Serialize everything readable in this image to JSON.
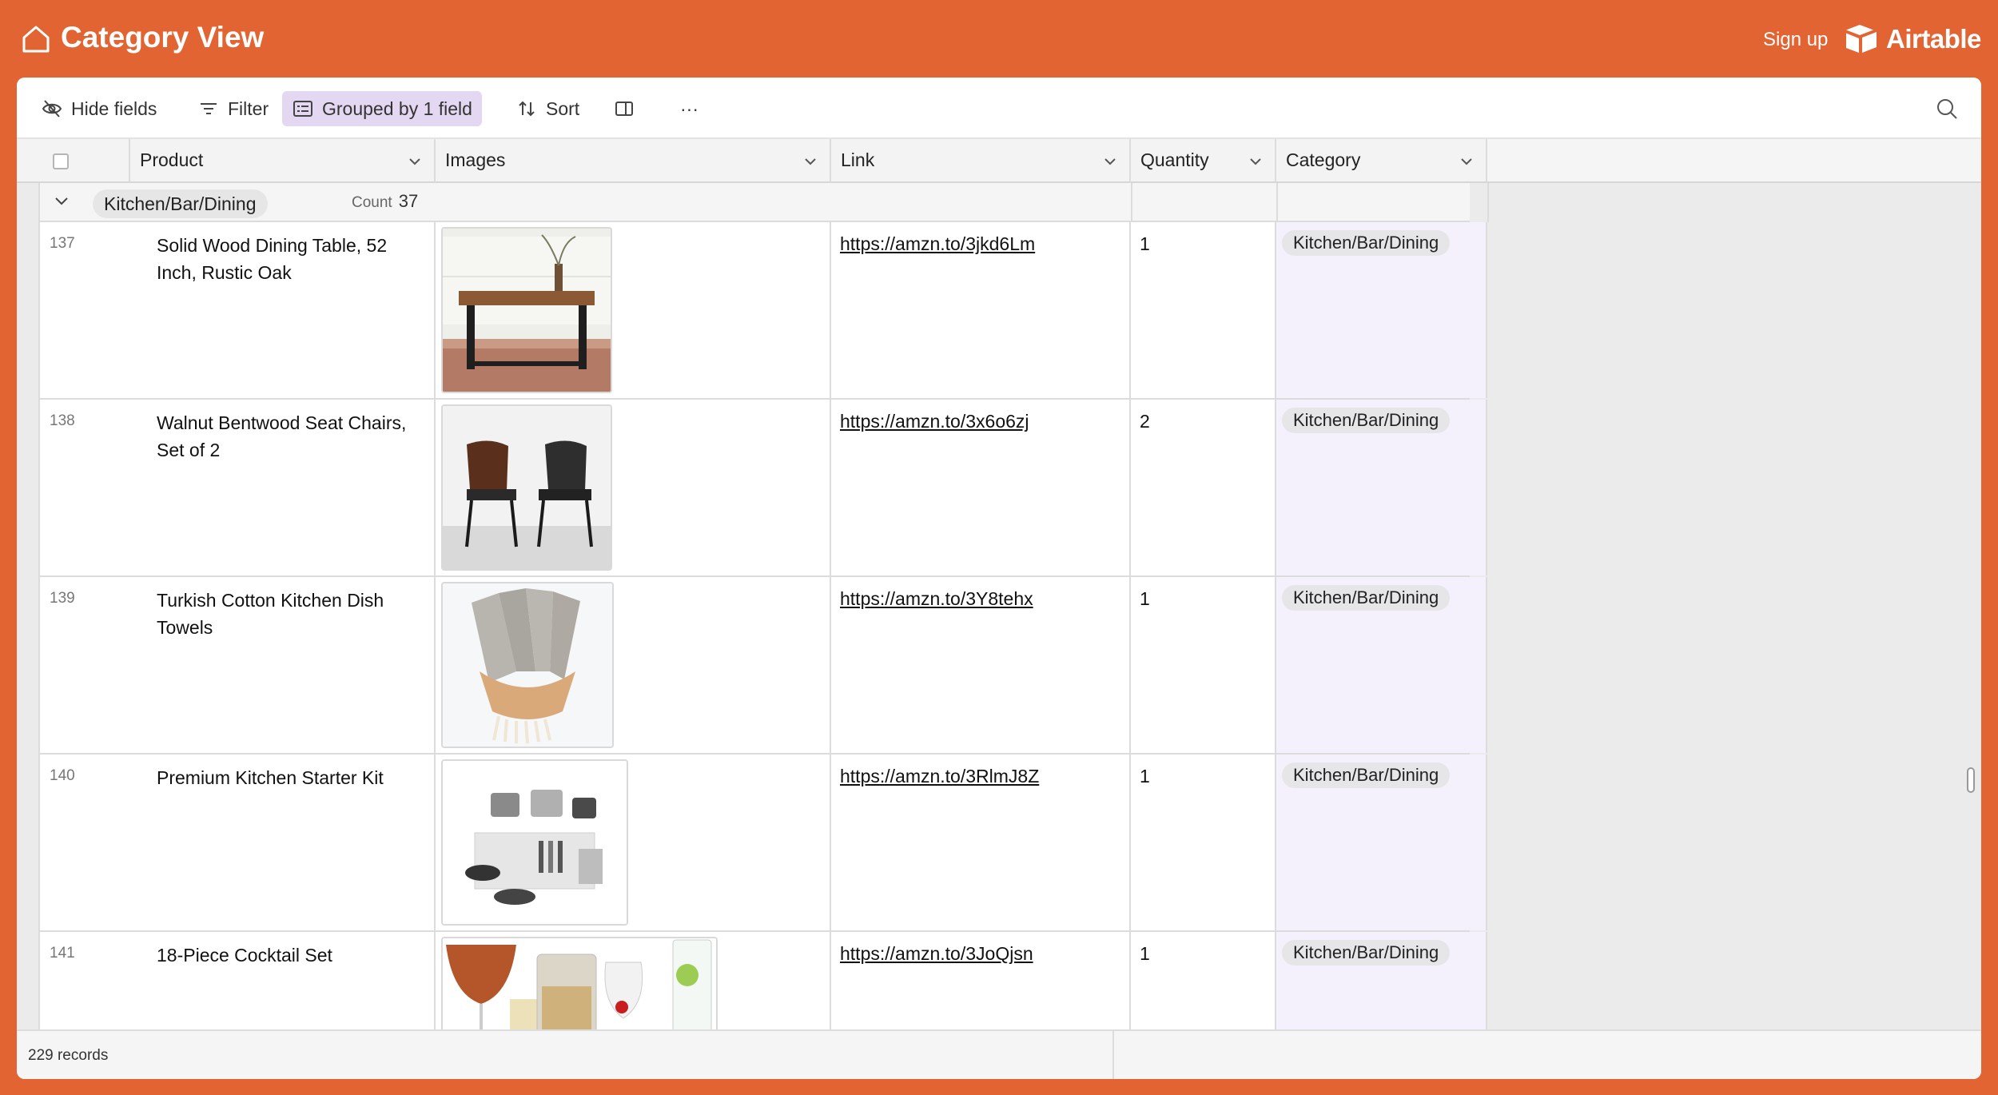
{
  "app": {
    "view_title": "Category View",
    "signup_label": "Sign up",
    "brand_name": "Airtable",
    "accent_color": "#e16432"
  },
  "toolbar": {
    "hide_fields": "Hide fields",
    "filter": "Filter",
    "grouped": "Grouped by 1 field",
    "sort": "Sort",
    "more": "···"
  },
  "columns": {
    "product": "Product",
    "images": "Images",
    "link": "Link",
    "quantity": "Quantity",
    "category": "Category"
  },
  "group": {
    "name": "Kitchen/Bar/Dining",
    "count_label": "Count",
    "count": "37"
  },
  "rows": [
    {
      "num": "137",
      "product": "Solid Wood Dining Table, 52 Inch, Rustic Oak",
      "image": "dining-table",
      "link": "https://amzn.to/3jkd6Lm",
      "quantity": "1",
      "category": "Kitchen/Bar/Dining"
    },
    {
      "num": "138",
      "product": "Walnut Bentwood Seat Chairs, Set of 2",
      "image": "chairs",
      "link": "https://amzn.to/3x6o6zj",
      "quantity": "2",
      "category": "Kitchen/Bar/Dining"
    },
    {
      "num": "139",
      "product": "Turkish Cotton Kitchen Dish Towels",
      "image": "towels",
      "link": "https://amzn.to/3Y8tehx",
      "quantity": "1",
      "category": "Kitchen/Bar/Dining"
    },
    {
      "num": "140",
      "product": "Premium Kitchen Starter Kit",
      "image": "kitchen-kit",
      "link": "https://amzn.to/3RlmJ8Z",
      "quantity": "1",
      "category": "Kitchen/Bar/Dining"
    },
    {
      "num": "141",
      "product": "18-Piece Cocktail Set",
      "image": "cocktail-set",
      "link": "https://amzn.to/3JoQjsn",
      "quantity": "1",
      "category": "Kitchen/Bar/Dining"
    }
  ],
  "footer": {
    "records": "229 records"
  }
}
